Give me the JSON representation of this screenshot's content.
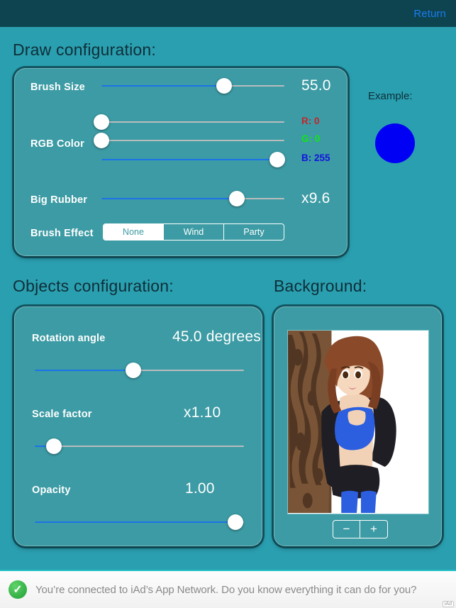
{
  "navbar": {
    "return_label": "Return"
  },
  "draw_section": {
    "title": "Draw configuration:",
    "brush_size": {
      "label": "Brush Size",
      "value": "55.0",
      "percent": 67
    },
    "rgb": {
      "label": "RGB Color",
      "r": {
        "text": "R: 0",
        "percent": 0,
        "color": "#c4262c"
      },
      "g": {
        "text": "G: 0",
        "percent": 0,
        "color": "#13e613"
      },
      "b": {
        "text": "B: 255",
        "percent": 96,
        "color": "#1414dc"
      }
    },
    "big_rubber": {
      "label": "Big Rubber",
      "value": "x9.6",
      "percent": 74
    },
    "brush_effect": {
      "label": "Brush Effect",
      "options": [
        "None",
        "Wind",
        "Party"
      ],
      "selected_index": 0
    }
  },
  "example": {
    "label": "Example:",
    "color": "#0000f5"
  },
  "objects_section": {
    "title": "Objects configuration:",
    "rotation": {
      "label": "Rotation angle",
      "value": "45.0 degrees",
      "percent": 47
    },
    "scale": {
      "label": "Scale factor",
      "value": "x1.10",
      "percent": 9
    },
    "opacity": {
      "label": "Opacity",
      "value": "1.00",
      "percent": 96
    }
  },
  "background_section": {
    "title": "Background:",
    "stepper": {
      "minus_label": "−",
      "plus_label": "+"
    },
    "thumbnail_name": "character-illustration"
  },
  "ad": {
    "icon": "green-check-icon",
    "text": "You’re connected to iAd’s App Network. Do you know everything it can do for you?",
    "tag": "iAd"
  }
}
